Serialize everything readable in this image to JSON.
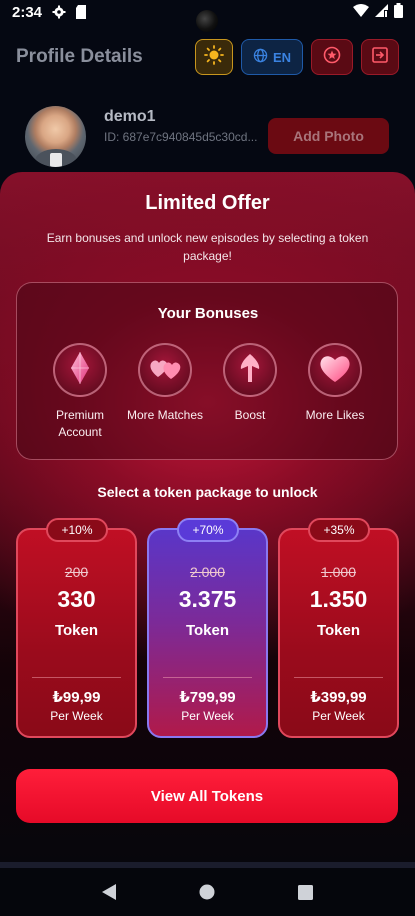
{
  "status_bar": {
    "time": "2:34",
    "icons": [
      "settings-gear-icon",
      "sd-card-icon",
      "wifi-icon",
      "signal-icon",
      "battery-icon"
    ]
  },
  "header": {
    "title": "Profile Details",
    "theme_icon": "sun-icon",
    "language_label": "EN",
    "language_icon": "globe-icon",
    "star_icon": "star-badge-icon",
    "logout_icon": "logout-icon"
  },
  "profile": {
    "username": "demo1",
    "user_id": "ID: 687e7c940845d5c30cd...",
    "add_photo_label": "Add Photo"
  },
  "offer": {
    "title": "Limited Offer",
    "description": "Earn bonuses and unlock new episodes by selecting a token package!",
    "bonuses_title": "Your Bonuses",
    "bonuses": [
      {
        "label": "Premium Account",
        "icon": "diamond-icon"
      },
      {
        "label": "More Matches",
        "icon": "double-heart-icon"
      },
      {
        "label": "Boost",
        "icon": "arrow-up-icon"
      },
      {
        "label": "More Likes",
        "icon": "heart-icon"
      }
    ],
    "select_title": "Select a token package to unlock",
    "packages": [
      {
        "bonus": "+10%",
        "old_amount": "200",
        "amount": "330",
        "unit": "Token",
        "price": "₺99,99",
        "period": "Per Week",
        "featured": false
      },
      {
        "bonus": "+70%",
        "old_amount": "2.000",
        "amount": "3.375",
        "unit": "Token",
        "price": "₺799,99",
        "period": "Per Week",
        "featured": true
      },
      {
        "bonus": "+35%",
        "old_amount": "1.000",
        "amount": "1.350",
        "unit": "Token",
        "price": "₺399,99",
        "period": "Per Week",
        "featured": false
      }
    ],
    "view_all_label": "View All Tokens"
  },
  "nav": {
    "icons": [
      "back-icon",
      "home-icon",
      "recents-icon"
    ]
  }
}
